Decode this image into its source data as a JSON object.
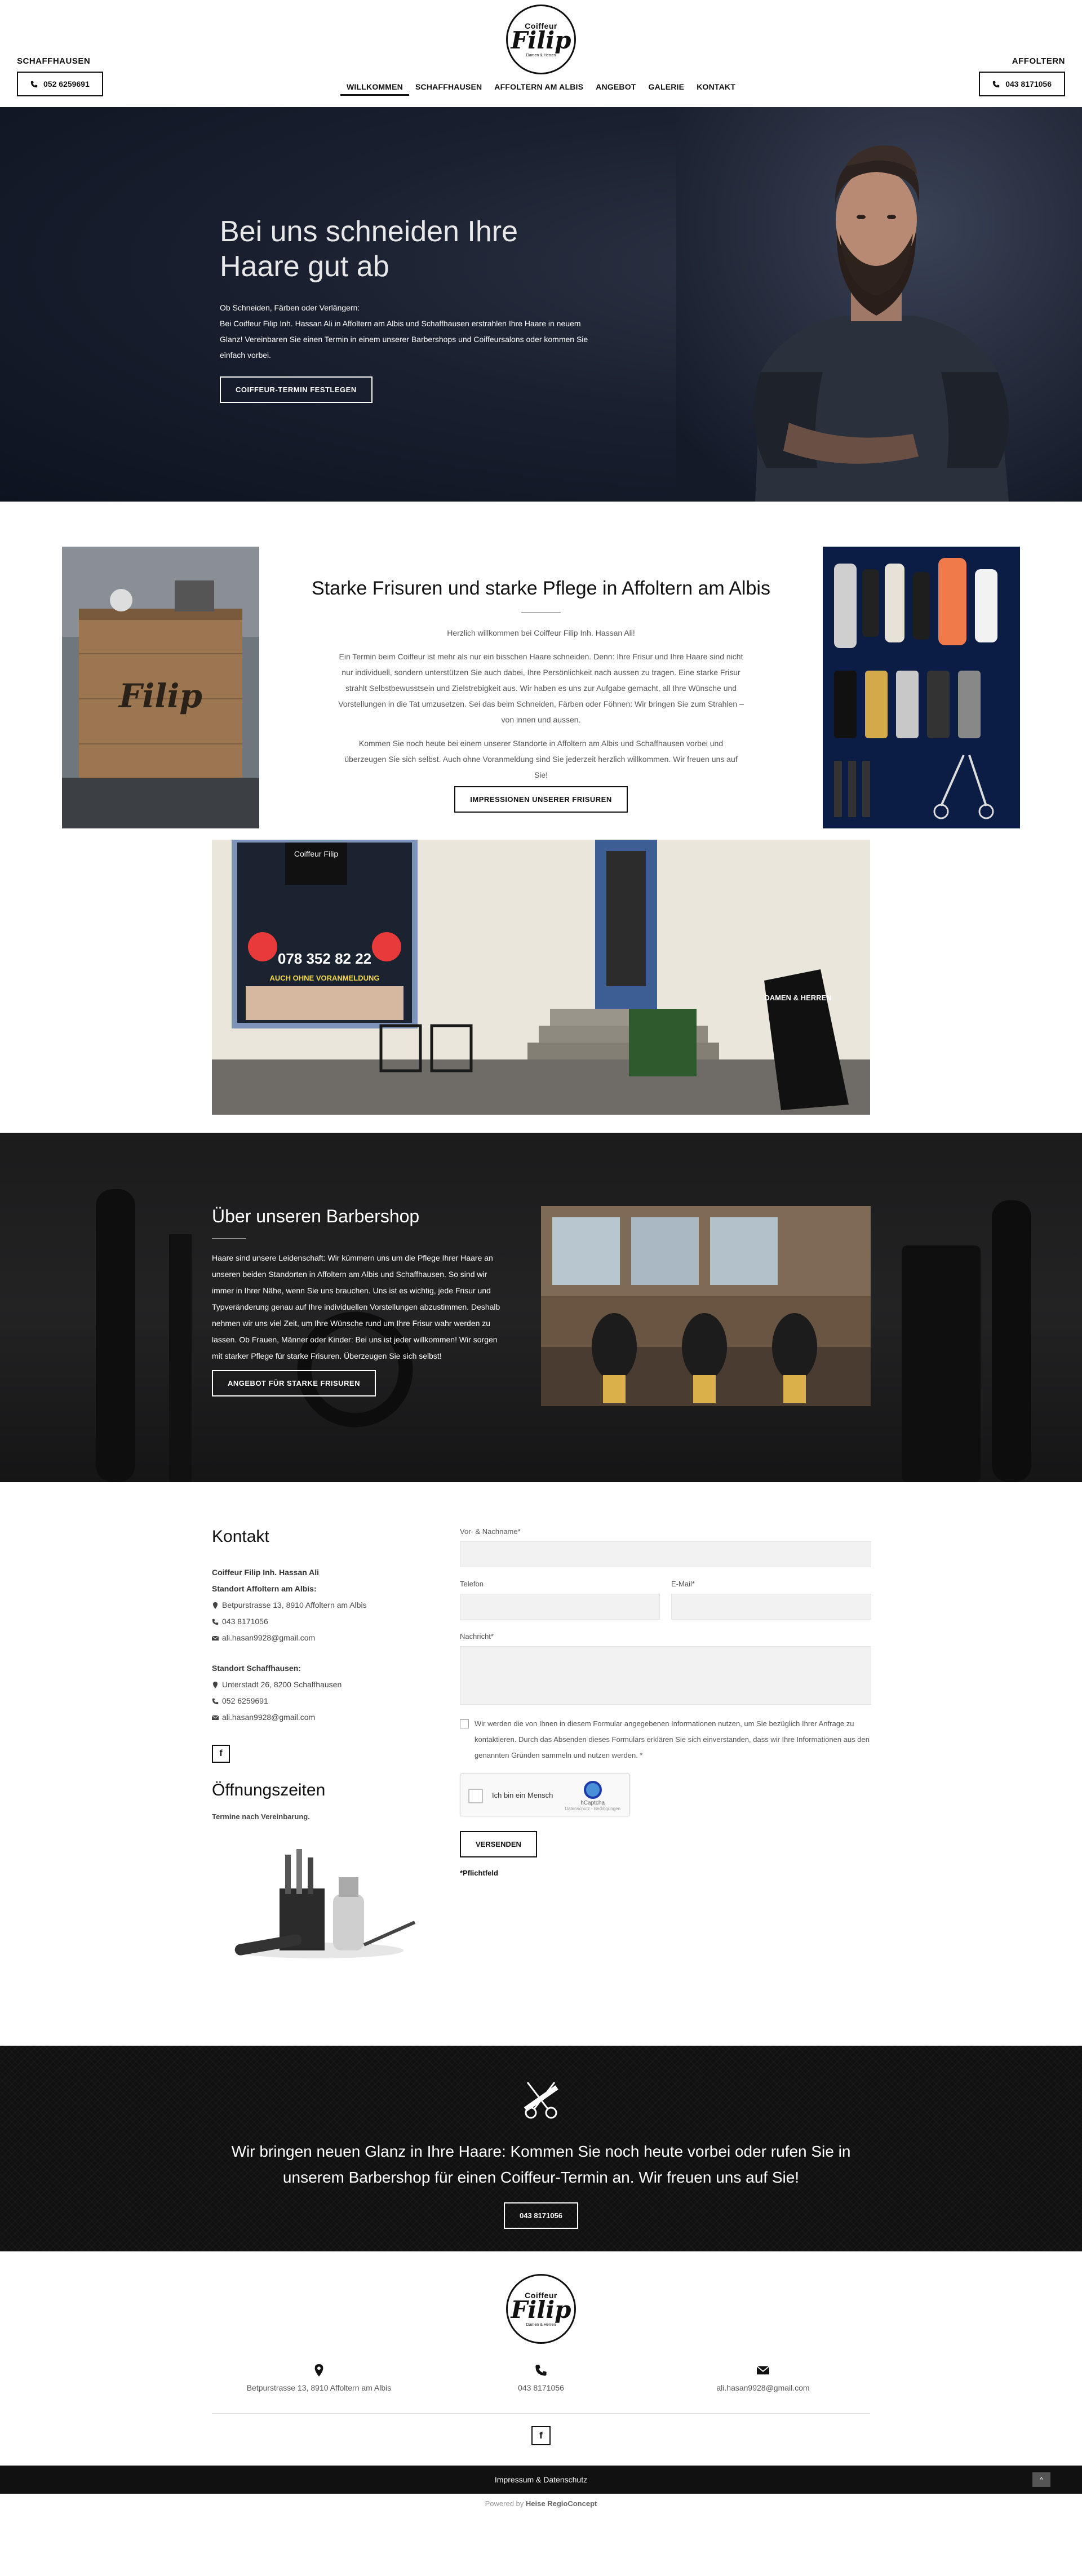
{
  "header": {
    "left_location": "SCHAFFHAUSEN",
    "left_phone": "052 6259691",
    "right_location": "AFFOLTERN",
    "right_phone": "043 8171056",
    "logo": {
      "top": "Coiffeur",
      "name": "Filip",
      "sub": "Damen & Herren"
    },
    "nav": [
      "WILLKOMMEN",
      "SCHAFFHAUSEN",
      "AFFOLTERN AM ALBIS",
      "ANGEBOT",
      "GALERIE",
      "KONTAKT"
    ]
  },
  "hero": {
    "title_1": "Bei uns schneiden Ihre",
    "title_2": "Haare gut ab",
    "p1": "Ob Schneiden, Färben oder Verlängern:",
    "p2": "Bei Coiffeur Filip Inh. Hassan Ali in Affoltern am Albis und Schaffhausen erstrahlen Ihre Haare in neuem Glanz! Vereinbaren Sie einen Termin in einem unserer Barbershops und Coiffeursalons oder kommen Sie einfach vorbei.",
    "button": "COIFFEUR-TERMIN FESTLEGEN"
  },
  "intro": {
    "title": "Starke Frisuren und starke Pflege in Affoltern am Albis",
    "welcome": "Herzlich willkommen bei Coiffeur Filip Inh. Hassan Ali!",
    "p1": "Ein Termin beim Coiffeur ist mehr als nur ein bisschen Haare schneiden. Denn: Ihre Frisur und Ihre Haare sind nicht nur individuell, sondern unterstützen Sie auch dabei, Ihre Persönlichkeit nach aussen zu tragen. Eine starke Frisur strahlt Selbstbewusstsein und Zielstrebigkeit aus. Wir haben es uns zur Aufgabe gemacht, all Ihre Wünsche und Vorstellungen in die Tat umzusetzen. Sei das beim Schneiden, Färben oder Föhnen: Wir bringen Sie zum Strahlen – von innen und aussen.",
    "p2": "Kommen Sie noch heute bei einem unserer Standorte in Affoltern am Albis und Schaffhausen vorbei und überzeugen Sie sich selbst. Auch ohne Voranmeldung sind Sie jederzeit herzlich willkommen. Wir freuen uns auf Sie!",
    "button": "IMPRESSIONEN UNSERER FRISUREN",
    "shop_sign": "Coiffeur Filip",
    "phone_sign": "078 352 82 22",
    "walkin_sign": "AUCH OHNE VORANMELDUNG",
    "sign_damen": "DAMEN & HERREN"
  },
  "barber": {
    "title": "Über unseren Barbershop",
    "p": "Haare sind unsere Leidenschaft: Wir kümmern uns um die Pflege Ihrer Haare an unseren beiden Standorten in Affoltern am Albis und Schaffhausen. So sind wir immer in Ihrer Nähe, wenn Sie uns brauchen. Uns ist es wichtig, jede Frisur und Typveränderung genau auf Ihre individuellen Vorstellungen abzustimmen. Deshalb nehmen wir uns viel Zeit, um Ihre Wünsche rund um Ihre Frisur wahr werden zu lassen. Ob Frauen, Männer oder Kinder: Bei uns ist jeder willkommen! Wir sorgen mit starker Pflege für starke Frisuren. Überzeugen Sie sich selbst!",
    "button": "ANGEBOT FÜR STARKE FRISUREN"
  },
  "contact": {
    "title": "Kontakt",
    "company": "Coiffeur Filip Inh. Hassan Ali",
    "loc1_title": "Standort Affoltern am Albis:",
    "loc1_address": "Betpurstrasse 13, 8910 Affoltern am Albis",
    "loc1_phone": "043 8171056",
    "loc1_email": "ali.hasan9928@gmail.com",
    "loc2_title": "Standort Schaffhausen:",
    "loc2_address": "Unterstadt 26, 8200 Schaffhausen",
    "loc2_phone": "052 6259691",
    "loc2_email": "ali.hasan9928@gmail.com",
    "facebook": "f",
    "hours_title": "Öffnungszeiten",
    "hours_text": "Termine nach Vereinbarung."
  },
  "form": {
    "name_label": "Vor- & Nachname*",
    "phone_label": "Telefon",
    "email_label": "E-Mail*",
    "message_label": "Nachricht*",
    "consent": "Wir werden die von Ihnen in diesem Formular angegebenen Informationen nutzen, um Sie bezüglich Ihrer Anfrage zu kontaktieren. Durch das Absenden dieses Formulars erklären Sie sich einverstanden, dass wir Ihre Informationen aus den genannten Gründen sammeln und nutzen werden. *",
    "captcha_text": "Ich bin ein Mensch",
    "captcha_brand": "hCaptcha",
    "captcha_sub": "Datenschutz - Bedingungen",
    "submit": "VERSENDEN",
    "required_note": "*Pflichtfeld"
  },
  "cta": {
    "text": "Wir bringen neuen Glanz in Ihre Haare: Kommen Sie noch heute vorbei oder rufen Sie in unserem Barbershop für einen Coiffeur-Termin an. Wir freuen uns auf Sie!",
    "button": "043 8171056"
  },
  "footer": {
    "address": "Betpurstrasse 13, 8910 Affoltern am Albis",
    "phone": "043 8171056",
    "email": "ali.hasan9928@gmail.com",
    "facebook": "f",
    "imprint": "Impressum & Datenschutz",
    "top_arrow": "^",
    "powered_by": "Powered by",
    "powered_brand": "Heise RegioConcept"
  }
}
